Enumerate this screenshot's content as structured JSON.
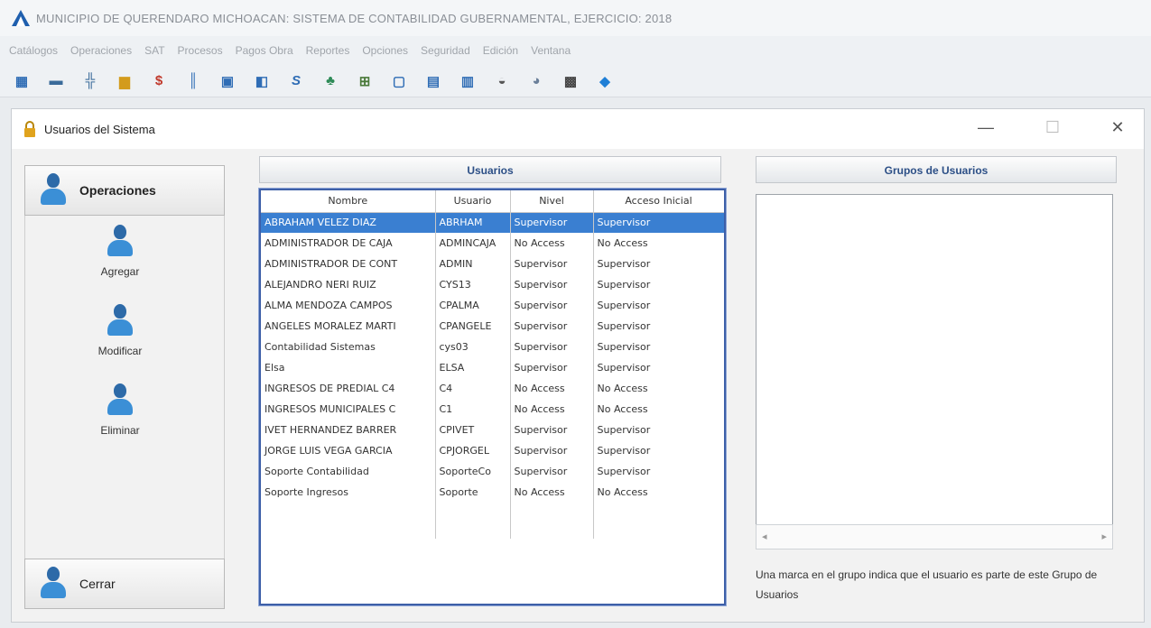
{
  "app": {
    "title": "MUNICIPIO DE QUERENDARO MICHOACAN: SISTEMA DE CONTABILIDAD GUBERNAMENTAL, EJERCICIO: 2018"
  },
  "menu": [
    "Catálogos",
    "Operaciones",
    "SAT",
    "Procesos",
    "Pagos Obra",
    "Reportes",
    "Opciones",
    "Seguridad",
    "Edición",
    "Ventana"
  ],
  "toolbar_icons": [
    "grid-icon",
    "list-icon",
    "split-icon",
    "bar-chart-icon",
    "dollar-book-icon",
    "columns-icon",
    "window-icon",
    "book-icon",
    "dollar-icon",
    "leaf-icon",
    "tree-icon",
    "document-icon",
    "calculator-icon",
    "note-icon",
    "car-icon",
    "users-icon",
    "printer-icon",
    "exit-icon"
  ],
  "window": {
    "title": "Usuarios del Sistema",
    "minimize": "—",
    "maximize": "☐",
    "close": "✕"
  },
  "left": {
    "operations": "Operaciones",
    "add": "Agregar",
    "modify": "Modificar",
    "delete": "Eliminar",
    "close": "Cerrar"
  },
  "users": {
    "header": "Usuarios",
    "columns": [
      "Nombre",
      "Usuario",
      "Nivel",
      "Acceso Inicial"
    ],
    "selected_row": 0,
    "rows": [
      [
        "ABRAHAM VELEZ DIAZ",
        "ABRHAM",
        "Supervisor",
        "Supervisor"
      ],
      [
        "ADMINISTRADOR DE CAJA",
        "ADMINCAJA",
        "No Access",
        "No Access"
      ],
      [
        "ADMINISTRADOR DE CONT",
        "ADMIN",
        "Supervisor",
        "Supervisor"
      ],
      [
        "ALEJANDRO NERI RUIZ",
        "CYS13",
        "Supervisor",
        "Supervisor"
      ],
      [
        "ALMA MENDOZA CAMPOS",
        "CPALMA",
        "Supervisor",
        "Supervisor"
      ],
      [
        "ANGELES MORALEZ MARTI",
        "CPANGELE",
        "Supervisor",
        "Supervisor"
      ],
      [
        "Contabilidad Sistemas",
        "cys03",
        "Supervisor",
        "Supervisor"
      ],
      [
        "Elsa",
        "ELSA",
        "Supervisor",
        "Supervisor"
      ],
      [
        "INGRESOS DE PREDIAL C4",
        "C4",
        "No Access",
        "No Access"
      ],
      [
        "INGRESOS MUNICIPALES C",
        "C1",
        "No Access",
        "No Access"
      ],
      [
        "IVET HERNANDEZ BARRER",
        "CPIVET",
        "Supervisor",
        "Supervisor"
      ],
      [
        "JORGE LUIS VEGA GARCIA",
        "CPJORGEL",
        "Supervisor",
        "Supervisor"
      ],
      [
        "Soporte Contabilidad",
        "SoporteCo",
        "Supervisor",
        "Supervisor"
      ],
      [
        "Soporte Ingresos",
        "Soporte",
        "No Access",
        "No Access"
      ]
    ]
  },
  "groups": {
    "header": "Grupos de Usuarios",
    "note": "Una marca en el grupo indica que el usuario es parte de este Grupo de Usuarios"
  },
  "colors": {
    "accent": "#2c4f86",
    "selection": "#3a7fd1",
    "grid_border": "#3d5fa8"
  }
}
